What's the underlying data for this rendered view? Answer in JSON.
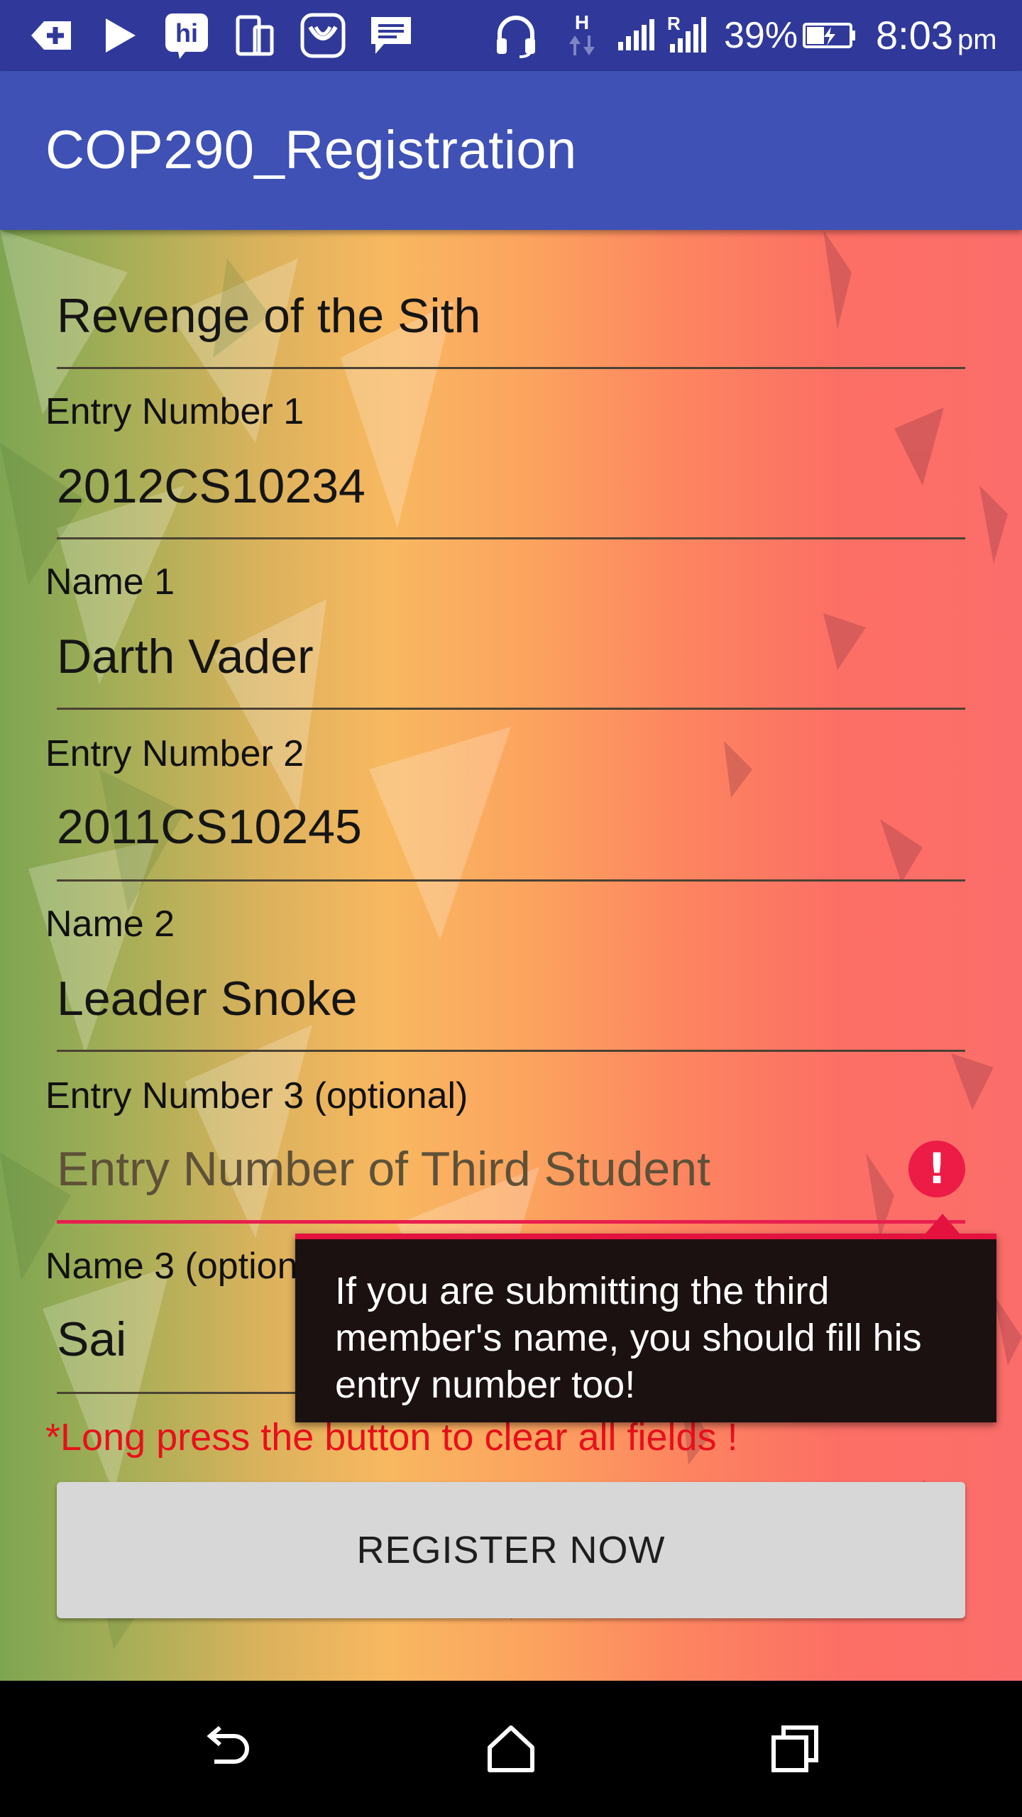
{
  "status_bar": {
    "battery_percent": "39%",
    "time": "8:03",
    "time_suffix": "pm",
    "network_h": "H",
    "network_r": "R"
  },
  "app_bar": {
    "title": "COP290_Registration"
  },
  "form": {
    "team_name_value": "Revenge of the Sith",
    "entry1_label": "Entry Number 1",
    "entry1_value": "2012CS10234",
    "name1_label": "Name 1",
    "name1_value": "Darth Vader",
    "entry2_label": "Entry Number 2",
    "entry2_value": "2011CS10245",
    "name2_label": "Name 2",
    "name2_value": "Leader Snoke",
    "entry3_label": "Entry Number 3 (optional)",
    "entry3_placeholder": "Entry Number of Third Student",
    "name3_label": "Name 3 (optional)",
    "name3_value": "Sai",
    "error_icon_glyph": "!",
    "error_message": "If you are submitting the third member's name, you should fill his entry number too!",
    "hint": "*Long press the button to clear all fields !",
    "register_button": "REGISTER NOW"
  },
  "colors": {
    "status_bar": "#30399a",
    "app_bar": "#3f51b5",
    "error": "#e91e4f",
    "hint": "#e8101a",
    "button": "#d7d7d7"
  }
}
